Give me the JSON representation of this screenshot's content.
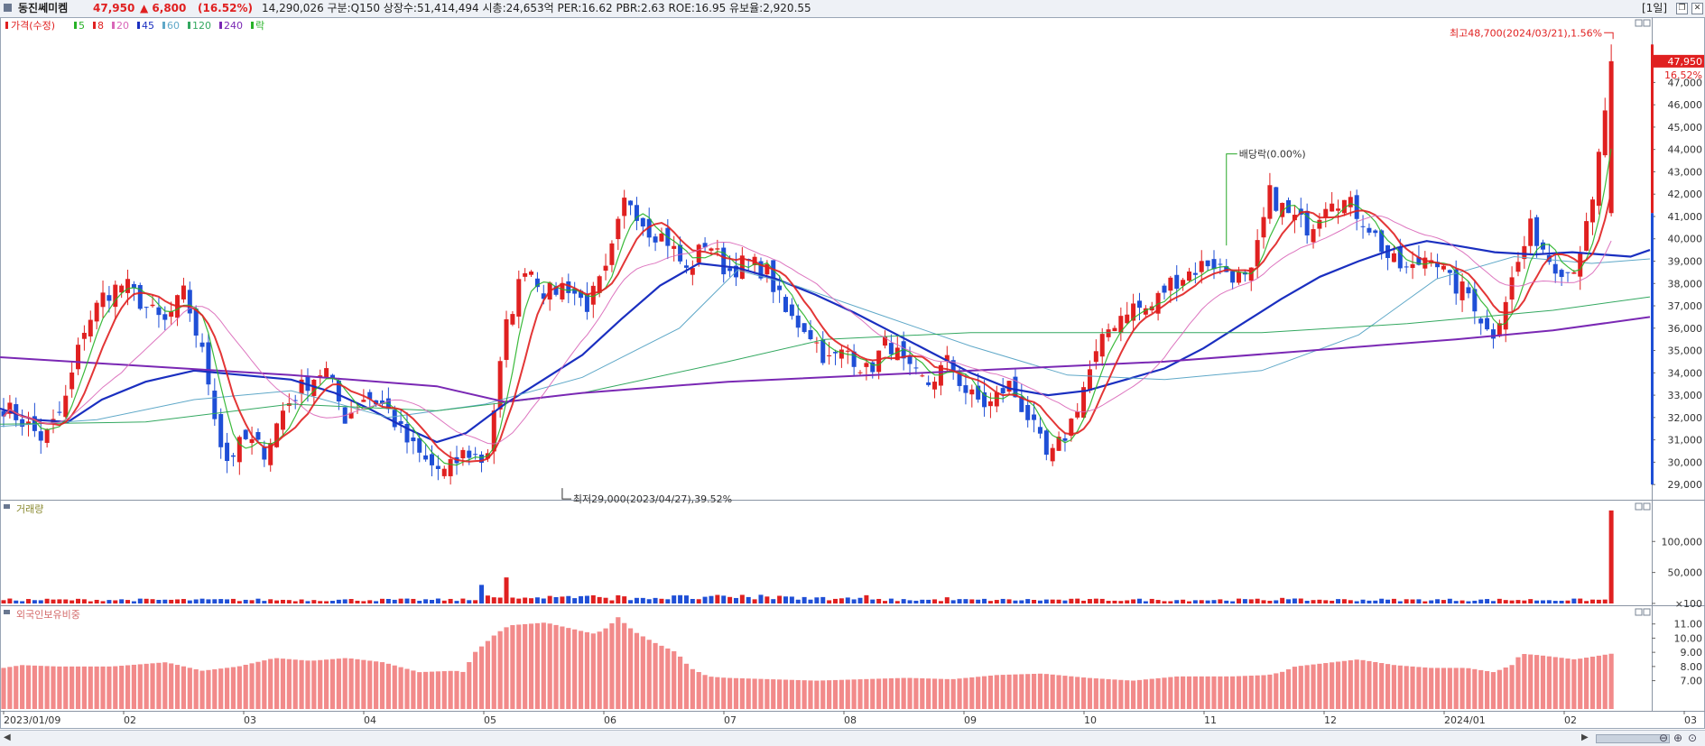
{
  "header": {
    "stock_name": "동진쎄미켐",
    "price": "47,950",
    "change": "▲ 6,800",
    "change_pct": "(16.52%)",
    "info": "14,290,026  구분:Q150  상장수:51,414,494  시총:24,653억  PER:16.62  PBR:2.63  ROE:16.95  유보율:2,920.55",
    "period": "[1일]",
    "up_color": "#e02020",
    "down_color": "#1f4fd6"
  },
  "legend": {
    "price_label": "가격(수정)",
    "ma": [
      {
        "label": "5",
        "color": "#27b227"
      },
      {
        "label": "8",
        "color": "#e02020"
      },
      {
        "label": "20",
        "color": "#d966b8"
      },
      {
        "label": "45",
        "color": "#1a2fc0"
      },
      {
        "label": "60",
        "color": "#5fa8c8"
      },
      {
        "label": "120",
        "color": "#33a860"
      },
      {
        "label": "240",
        "color": "#7a28b4"
      }
    ],
    "ex_label": "락"
  },
  "panes": {
    "volume_title": "거래량",
    "foreign_title": "외국인보유비중"
  },
  "annotations": {
    "high": "최고48,700(2024/03/21),1.56%",
    "low": "최저29,000(2023/04/27),39.52%",
    "dividend": "배당락(0.00%)",
    "last_price": "47,950",
    "last_pct": "16.52%"
  },
  "chart_data": [
    {
      "type": "candlestick",
      "x_labels": [
        "2023/01/09",
        "02",
        "03",
        "04",
        "05",
        "06",
        "07",
        "08",
        "09",
        "10",
        "11",
        "12",
        "2024/01",
        "02",
        "03"
      ],
      "y_ticks": [
        29000,
        30000,
        31000,
        32000,
        33000,
        34000,
        35000,
        36000,
        37000,
        38000,
        39000,
        40000,
        41000,
        42000,
        43000,
        44000,
        45000,
        46000,
        47000
      ],
      "ylim": [
        28400,
        49600
      ],
      "high": 48700,
      "low": 29000,
      "close_path": [
        32500,
        31800,
        31000,
        32500,
        36000,
        37500,
        38000,
        37000,
        36200,
        37600,
        34500,
        30000,
        31000,
        30500,
        32500,
        33500,
        34200,
        32000,
        33000,
        32500,
        31000,
        30000,
        29500,
        30500,
        30000,
        36000,
        39000,
        37500,
        38000,
        37000,
        38500,
        42000,
        40500,
        40000,
        38500,
        40000,
        38500,
        39000,
        38500,
        36500,
        36000,
        34500,
        35000,
        34000,
        35500,
        34000,
        33500,
        34500,
        33000,
        32500,
        33500,
        32000,
        30000,
        31500,
        34000,
        36000,
        37000,
        36800,
        38000,
        38500,
        39000,
        38500,
        38000,
        42000,
        41000,
        40500,
        42000,
        41500,
        40500,
        39000,
        38500,
        39500,
        38000,
        37500,
        35500,
        38000,
        40500,
        39000,
        38500,
        41000,
        47950
      ],
      "ma_lines": [
        {
          "name": "45",
          "points": [
            [
              0,
              32400
            ],
            [
              35,
              31900
            ],
            [
              70,
              31800
            ],
            [
              105,
              32800
            ],
            [
              150,
              33600
            ],
            [
              200,
              34100
            ],
            [
              250,
              33900
            ],
            [
              300,
              33700
            ],
            [
              345,
              33100
            ],
            [
              380,
              32400
            ],
            [
              420,
              31500
            ],
            [
              450,
              30900
            ],
            [
              480,
              31300
            ],
            [
              520,
              32600
            ],
            [
              560,
              33700
            ],
            [
              600,
              34800
            ],
            [
              640,
              36400
            ],
            [
              680,
              37900
            ],
            [
              720,
              38900
            ],
            [
              760,
              38700
            ],
            [
              800,
              38200
            ],
            [
              840,
              37500
            ],
            [
              880,
              36700
            ],
            [
              920,
              35800
            ],
            [
              960,
              34900
            ],
            [
              1000,
              34000
            ],
            [
              1040,
              33300
            ],
            [
              1080,
              33000
            ],
            [
              1120,
              33200
            ],
            [
              1160,
              33700
            ],
            [
              1200,
              34200
            ],
            [
              1240,
              35100
            ],
            [
              1280,
              36200
            ],
            [
              1320,
              37300
            ],
            [
              1360,
              38300
            ],
            [
              1400,
              39000
            ],
            [
              1440,
              39600
            ],
            [
              1470,
              39900
            ],
            [
              1500,
              39700
            ],
            [
              1540,
              39400
            ],
            [
              1580,
              39300
            ],
            [
              1620,
              39400
            ],
            [
              1650,
              39300
            ],
            [
              1680,
              39200
            ],
            [
              1700,
              39500
            ]
          ]
        },
        {
          "name": "60",
          "points": [
            [
              0,
              31600
            ],
            [
              100,
              31900
            ],
            [
              200,
              32800
            ],
            [
              300,
              33200
            ],
            [
              400,
              32000
            ],
            [
              500,
              32600
            ],
            [
              600,
              33800
            ],
            [
              700,
              36000
            ],
            [
              760,
              38600
            ],
            [
              820,
              37900
            ],
            [
              900,
              36700
            ],
            [
              1000,
              35200
            ],
            [
              1100,
              33900
            ],
            [
              1200,
              33700
            ],
            [
              1300,
              34100
            ],
            [
              1400,
              35700
            ],
            [
              1480,
              38200
            ],
            [
              1560,
              39200
            ],
            [
              1640,
              38900
            ],
            [
              1700,
              39100
            ]
          ]
        },
        {
          "name": "120",
          "points": [
            [
              0,
              31700
            ],
            [
              150,
              31800
            ],
            [
              300,
              32600
            ],
            [
              450,
              32300
            ],
            [
              600,
              33100
            ],
            [
              750,
              34500
            ],
            [
              850,
              35500
            ],
            [
              1000,
              35800
            ],
            [
              1150,
              35800
            ],
            [
              1300,
              35800
            ],
            [
              1450,
              36200
            ],
            [
              1600,
              36800
            ],
            [
              1700,
              37400
            ]
          ]
        },
        {
          "name": "240",
          "points": [
            [
              0,
              34700
            ],
            [
              150,
              34300
            ],
            [
              300,
              33900
            ],
            [
              450,
              33400
            ],
            [
              520,
              32700
            ],
            [
              600,
              33100
            ],
            [
              750,
              33600
            ],
            [
              900,
              33900
            ],
            [
              1050,
              34200
            ],
            [
              1200,
              34500
            ],
            [
              1350,
              35000
            ],
            [
              1500,
              35500
            ],
            [
              1600,
              35900
            ],
            [
              1700,
              36500
            ]
          ]
        }
      ]
    },
    {
      "type": "bar",
      "title": "거래량",
      "y_ticks": [
        100,
        50000,
        100000
      ],
      "ylim": [
        0,
        160000
      ],
      "last_value": 150000
    },
    {
      "type": "bar",
      "title": "외국인보유비중",
      "y_ticks": [
        7,
        8,
        9,
        10,
        11
      ],
      "ylim": [
        5.0,
        12.0
      ],
      "anchors": [
        [
          0,
          7.9
        ],
        [
          20,
          8.1
        ],
        [
          60,
          8.0
        ],
        [
          120,
          8.0
        ],
        [
          180,
          8.3
        ],
        [
          220,
          7.7
        ],
        [
          260,
          8.0
        ],
        [
          300,
          8.6
        ],
        [
          340,
          8.4
        ],
        [
          380,
          8.6
        ],
        [
          420,
          8.3
        ],
        [
          460,
          7.6
        ],
        [
          500,
          7.7
        ],
        [
          510,
          7.6
        ],
        [
          520,
          8.9
        ],
        [
          545,
          10.3
        ],
        [
          560,
          10.9
        ],
        [
          580,
          11.0
        ],
        [
          600,
          11.1
        ],
        [
          620,
          10.8
        ],
        [
          640,
          10.5
        ],
        [
          655,
          10.3
        ],
        [
          670,
          10.8
        ],
        [
          680,
          11.5
        ],
        [
          690,
          10.9
        ],
        [
          700,
          10.4
        ],
        [
          720,
          9.7
        ],
        [
          745,
          9.0
        ],
        [
          760,
          7.9
        ],
        [
          780,
          7.3
        ],
        [
          800,
          7.2
        ],
        [
          850,
          7.1
        ],
        [
          900,
          7.0
        ],
        [
          950,
          7.1
        ],
        [
          1000,
          7.2
        ],
        [
          1050,
          7.1
        ],
        [
          1100,
          7.4
        ],
        [
          1150,
          7.5
        ],
        [
          1200,
          7.2
        ],
        [
          1250,
          7.0
        ],
        [
          1300,
          7.3
        ],
        [
          1360,
          7.3
        ],
        [
          1400,
          7.4
        ],
        [
          1415,
          7.6
        ],
        [
          1430,
          8.0
        ],
        [
          1500,
          8.5
        ],
        [
          1540,
          8.1
        ],
        [
          1580,
          7.9
        ],
        [
          1620,
          7.9
        ],
        [
          1650,
          7.6
        ],
        [
          1670,
          8.1
        ],
        [
          1680,
          8.9
        ],
        [
          1700,
          8.8
        ],
        [
          1740,
          8.5
        ],
        [
          1780,
          8.9
        ]
      ]
    }
  ]
}
